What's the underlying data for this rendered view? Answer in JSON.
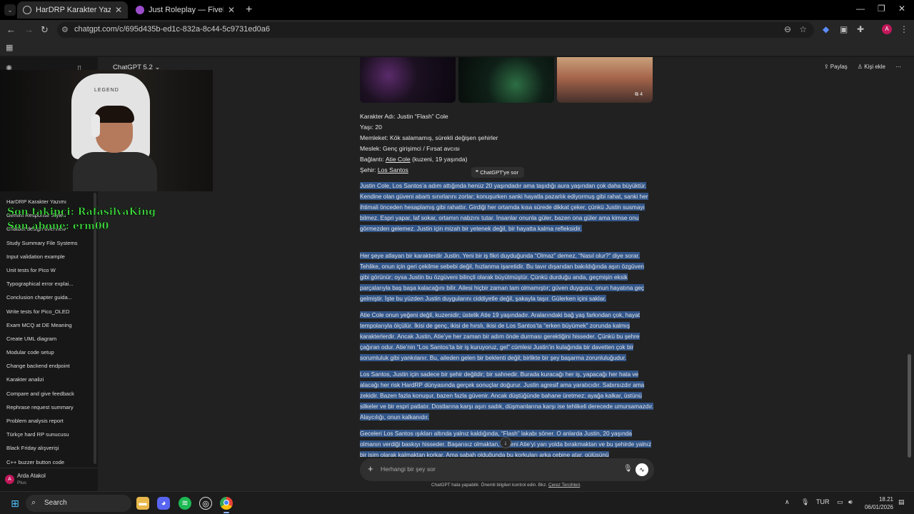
{
  "browser": {
    "tabs": [
      {
        "title": "HarDRP Karakter Yazımı",
        "active": true,
        "favicon_color": "#9e9e9e"
      },
      {
        "title": "Just Roleplay — FiveM Roleplay",
        "active": false,
        "favicon_color": "#9c4dcc"
      }
    ],
    "url": "chatgpt.com/c/695d435b-ed1c-832a-8c44-5c9731ed0a6",
    "profile_initial": "A"
  },
  "app": {
    "model_label": "ChatGPT 5.2",
    "share_label": "Paylaş",
    "add_person_label": "Kişi ekle"
  },
  "sidebar": {
    "chats": [
      "HarDRP Karakter Yazımı",
      "Gemini Response Styles",
      "Chatbot design overview",
      "Study Summary File Systems",
      "Input validation example",
      "Unit tests for Pico W",
      "Typographical error explai...",
      "Conclusion chapter guida...",
      "Write tests for Pico_OLED",
      "Exam MCQ at DE Meaning",
      "Create UML diagram",
      "Modular code setup",
      "Change backend endpoint",
      "Karakter analizi",
      "Compare and give feedback",
      "Rephrase request summary",
      "Problem analysis report",
      "Türkçe hard RP sunucusu",
      "Black Friday alışverişi",
      "C++ buzzer button code"
    ],
    "user": {
      "name": "Arda Atakol",
      "plan": "Plus",
      "initial": "A"
    }
  },
  "overlay": {
    "webcam_brand": "LEGEND",
    "last_follower": "Son takipçi: RafasilvaKing",
    "last_sub": "Son abone: erm00"
  },
  "conversation": {
    "image_count": "4",
    "facts": {
      "name": "Karakter Adı: Justin “Flash” Cole",
      "age": "Yaşı: 20",
      "hometown": "Memleket: Kök salamamış, sürekli değişen şehirler",
      "job": "Meslek: Genç girişimci / Fırsat avcısı",
      "link_prefix": "Bağlantı: ",
      "link_name": "Atie Cole",
      "link_suffix": " (kuzeni, 19 yaşında)",
      "city_prefix": "Şehir: ",
      "city_name": "Los Santos"
    },
    "ask_chatgpt": "ChatGPT'ye sor",
    "paragraphs": [
      "Justin Cole, Los Santos’a adım attığında henüz 20 yaşındadır ama taşıdığı aura yaşından çok daha büyüktür. Kendine olan güveni abartı sınırlarını zorlar; konuşurken sanki hayatla pazarlık ediyormuş gibi rahat, sanki her ihtimali önceden hesaplamış gibi rahattır. Girdiği her ortamda kısa sürede dikkat çeker, çünkü Justin susmayı bilmez. Espri yapar, laf sokar, ortamın nabzını tutar. İnsanlar onunla güler, bazen ona güler ama kimse onu görmezden gelemez. Justin için mizah bir yetenek değil, bir hayatta kalma refleksidir.",
      "Her şeye atlayan bir karakterdir Justin. Yeni bir iş fikri duyduğunda “Olmaz” demez, “Nasıl olur?” diye sorar. Tehlike, onun için geri çekilme sebebi değil, hızlanma işaretidir. Bu tavır dışarıdan bakıldığında aşırı özgüven gibi görünür; oysa Justin bu özgüveni bilinçli olarak büyütmüştür. Çünkü durduğu anda, geçmişin eksik parçalarıyla baş başa kalacağını bilir. Ailesi hiçbir zaman tam olmamıştır; güven duygusu, onun hayatına geç gelmiştir. İşte bu yüzden Justin duygularını ciddiyetle değil, şakayla taşır. Gülerken içini saklar.",
      "Atie Cole onun yeğeni değil, kuzenidir; üstelik Atie 19 yaşındadır. Aralarındaki bağ yaş farkından çok, hayat tempolarıyla ölçülür. İkisi de genç, ikisi de hırslı, ikisi de Los Santos’ta “erken büyümek” zorunda kalmış karakterlerdir. Ancak Justin, Atie’ye her zaman bir adım önde durması gerektiğini hisseder. Çünkü bu şehre çağıran odur. Atie’nin “Los Santos’ta bir iş kuruyoruz, gel” cümlesi Justin’in kulağında bir davetten çok bir sorumluluk gibi yankılanır. Bu, aileden gelen bir beklenti değil; birlikte bir şey başarma zorunluluğudur.",
      "Los Santos, Justin için sadece bir şehir değildir; bir sahnedir. Burada kuracağı her iş, yapacağı her hata ve alacağı her risk HardRP dünyasında gerçek sonuçlar doğurur. Justin agresif ama yaratıcıdır. Sabırsızdır ama zekidir. Bazen fazla konuşur, bazen fazla güvenir. Ancak düştüğünde bahane üretmez; ayağa kalkar, üstünü silkeler ve bir espri patlatır. Dostlarına karşı aşırı sadık, düşmanlarına karşı ise tehlikeli derecede umursamazdır. Alaycılığı, onun kalkanıdır.",
      "Geceleri Los Santos ışıkları altında yalnız kaldığında, “Flash” lakabı söner. O anlarda Justin, 20 yaşında olmanın verdiği baskıyı hisseder. Başarısız olmaktan, kuzeni Atie’yi yarı yolda bırakmaktan ve bu şehirde yalnız bir isim olarak kalmaktan korkar. Ama sabah olduğunda bu korkuları arka cebine atar, gülüşünü"
    ]
  },
  "composer": {
    "placeholder": "Herhangi bir şey sor",
    "disclaimer_main": "ChatGPT hata yapabilir. Önemli bilgileri kontrol edin. Bkz. ",
    "disclaimer_link": "Çerez Tercihleri",
    "disclaimer_end": "."
  },
  "taskbar": {
    "search_label": "Search",
    "lang": "TUR",
    "time": "18.21",
    "date": "06/01/2026"
  }
}
